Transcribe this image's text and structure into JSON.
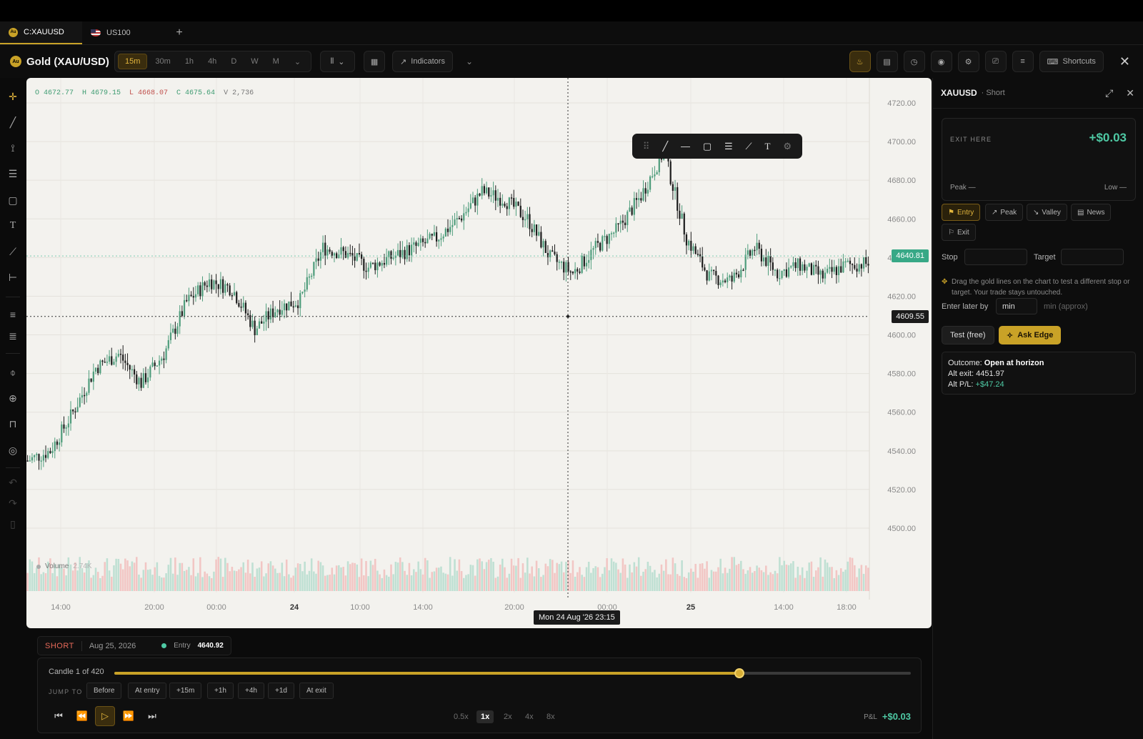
{
  "tabs": [
    {
      "label": "C:XAUUSD",
      "icon": "gold-coin-icon",
      "active": true
    },
    {
      "label": "US100",
      "icon": "us-flag-icon",
      "active": false
    }
  ],
  "header": {
    "coin_glyph": "Au",
    "symbol_name": "Gold (XAU/USD)",
    "timeframes": [
      "15m",
      "30m",
      "1h",
      "4h",
      "D",
      "W",
      "M"
    ],
    "active_timeframe": "15m",
    "indicators_label": "Indicators",
    "shortcuts_label": "Shortcuts"
  },
  "chart": {
    "ohlc": {
      "o": "O 4672.77",
      "h": "H 4679.15",
      "l": "L 4668.07",
      "c": "C 4675.64",
      "v": "V 2,736"
    },
    "volume_label": "Volume",
    "volume_value": "2.74K",
    "last_price_tag": "4640.81",
    "crosshair_price_tag": "4609.55",
    "crosshair_time_tag": "Mon 24 Aug '26  23:15",
    "colors": {
      "up": "#4f9d7c",
      "down": "#1e1e1e",
      "vol_up": "#bfe0d3",
      "vol_down": "#f2c6c4"
    }
  },
  "chart_data": {
    "type": "candlestick",
    "y_ticks": [
      "4720.00",
      "4700.00",
      "4680.00",
      "4660.00",
      "4640.00",
      "4620.00",
      "4600.00",
      "4580.00",
      "4560.00",
      "4540.00",
      "4520.00",
      "4500.00"
    ],
    "ylim": [
      4493,
      4725
    ],
    "x_ticks": [
      "14:00",
      "20:00",
      "00:00",
      "24",
      "10:00",
      "14:00",
      "20:00",
      "00:00",
      "25",
      "14:00",
      "18:00"
    ],
    "anchors": [
      [
        0,
        4535
      ],
      [
        10,
        4540
      ],
      [
        20,
        4560
      ],
      [
        30,
        4583
      ],
      [
        40,
        4590
      ],
      [
        50,
        4575
      ],
      [
        60,
        4590
      ],
      [
        70,
        4617
      ],
      [
        80,
        4628
      ],
      [
        90,
        4624
      ],
      [
        100,
        4603
      ],
      [
        110,
        4614
      ],
      [
        120,
        4618
      ],
      [
        130,
        4645
      ],
      [
        140,
        4642
      ],
      [
        150,
        4635
      ],
      [
        160,
        4640
      ],
      [
        170,
        4645
      ],
      [
        180,
        4650
      ],
      [
        190,
        4660
      ],
      [
        200,
        4674
      ],
      [
        210,
        4670
      ],
      [
        220,
        4660
      ],
      [
        230,
        4640
      ],
      [
        240,
        4632
      ],
      [
        250,
        4645
      ],
      [
        260,
        4655
      ],
      [
        270,
        4672
      ],
      [
        280,
        4695
      ],
      [
        290,
        4650
      ],
      [
        300,
        4630
      ],
      [
        310,
        4628
      ],
      [
        320,
        4645
      ],
      [
        330,
        4632
      ],
      [
        340,
        4636
      ],
      [
        350,
        4630
      ],
      [
        360,
        4636
      ],
      [
        370,
        4637
      ]
    ],
    "last": 4640.81,
    "crosshair_price": 4609.55
  },
  "drawing_toolbar": {
    "tools": [
      "drag-handle-icon",
      "trendline-icon",
      "horizontal-line-icon",
      "rectangle-icon",
      "fib-icon",
      "ruler-icon",
      "text-icon",
      "settings-icon"
    ]
  },
  "panel": {
    "symbol": "XAUUSD",
    "side": "· Short",
    "exit_label": "EXIT HERE",
    "exit_value": "+$0.03",
    "peak": "Peak —",
    "low": "Low —",
    "chips": [
      "Entry",
      "Peak",
      "Valley",
      "News",
      "Exit"
    ],
    "stop_label": "Stop",
    "target_label": "Target",
    "hint": "Drag the gold lines on the chart to test a different stop or target. Your trade stays untouched.",
    "enter_later_label": "Enter later by",
    "enter_later_value": "min",
    "enter_later_suffix": "min (approx)",
    "test_label": "Test (free)",
    "ask_label": "Ask Edge",
    "outcome_label": "Outcome:",
    "outcome_value": "Open at horizon",
    "alt_exit_label": "Alt exit:",
    "alt_exit_value": "4451.97",
    "alt_pl_label": "Alt P/L:",
    "alt_pl_value": "+$47.24"
  },
  "trade": {
    "side": "SHORT",
    "date": "Aug 25, 2026",
    "entry_label": "Entry",
    "entry_price": "4640.92"
  },
  "replay": {
    "candle_count": "Candle 1 of 420",
    "progress_fraction": 0.785,
    "jump_label": "JUMP TO",
    "jump_buttons": [
      "Before",
      "At entry",
      "+15m",
      "+1h",
      "+4h",
      "+1d",
      "At exit"
    ],
    "speeds": [
      "0.5x",
      "1x",
      "2x",
      "4x",
      "8x"
    ],
    "active_speed": "1x",
    "pl_label": "P&L",
    "pl_value": "+$0.03"
  }
}
